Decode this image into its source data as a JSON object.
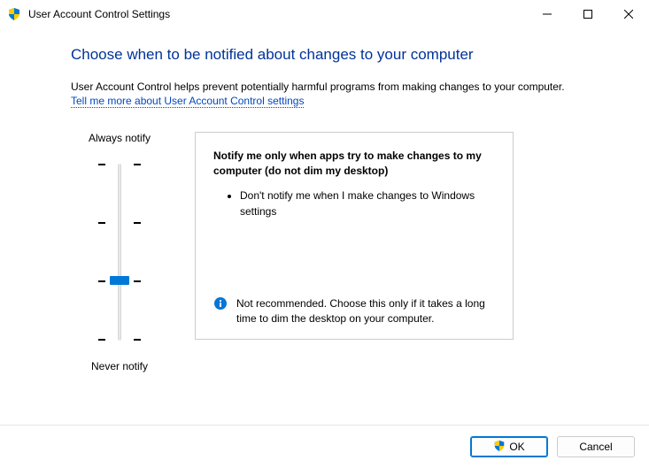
{
  "window": {
    "title": "User Account Control Settings"
  },
  "heading": "Choose when to be notified about changes to your computer",
  "description": "User Account Control helps prevent potentially harmful programs from making changes to your computer.",
  "link_text": "Tell me more about User Account Control settings",
  "slider": {
    "top_label": "Always notify",
    "bottom_label": "Never notify",
    "levels": 4,
    "current_index": 2
  },
  "panel": {
    "title": "Notify me only when apps try to make changes to my computer (do not dim my desktop)",
    "bullet": "Don't notify me when I make changes to Windows settings",
    "footer": "Not recommended. Choose this only if it takes a long time to dim the desktop on your computer."
  },
  "buttons": {
    "ok": "OK",
    "cancel": "Cancel"
  }
}
